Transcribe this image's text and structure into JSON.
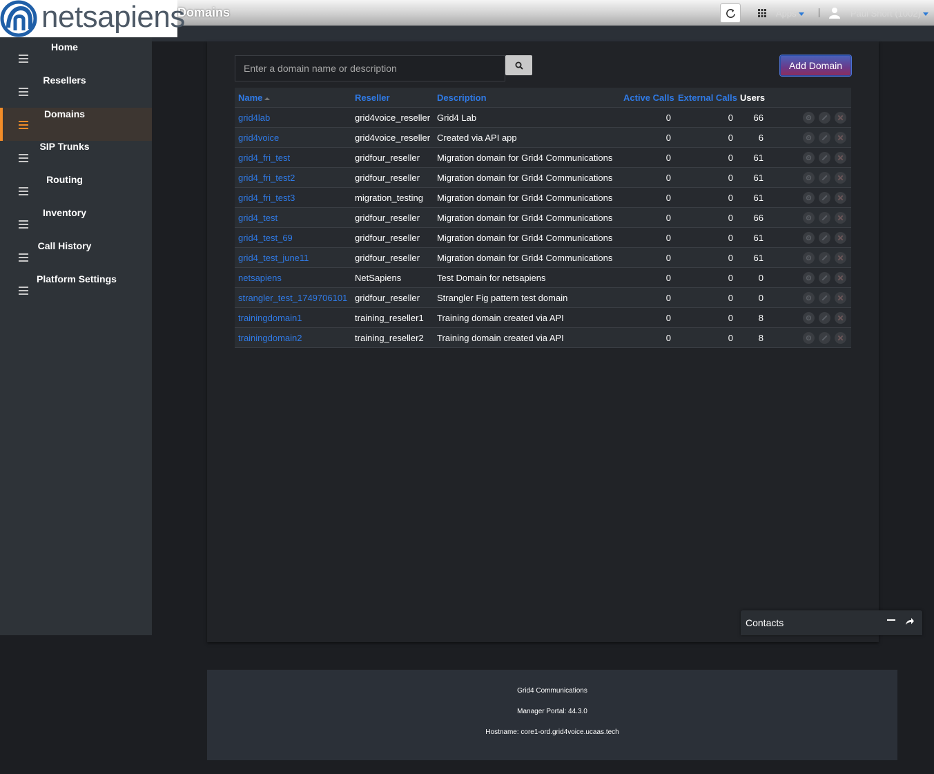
{
  "brand": {
    "logo_text": "netsapiens"
  },
  "header": {
    "page_title": "Domains",
    "apps_label": "Apps",
    "user_label": "Paul Short (1002)"
  },
  "sidebar": {
    "items": [
      {
        "label": "Home"
      },
      {
        "label": "Resellers"
      },
      {
        "label": "Domains",
        "active": true
      },
      {
        "label": "SIP Trunks"
      },
      {
        "label": "Routing"
      },
      {
        "label": "Inventory"
      },
      {
        "label": "Call History"
      },
      {
        "label": "Platform Settings"
      }
    ]
  },
  "search": {
    "placeholder": "Enter a domain name or description"
  },
  "toolbar": {
    "add_label": "Add Domain"
  },
  "table": {
    "headers": {
      "name": "Name",
      "reseller": "Reseller",
      "description": "Description",
      "active_calls": "Active Calls",
      "external_calls": "External Calls",
      "users": "Users"
    },
    "rows": [
      {
        "name": "grid4lab",
        "reseller": "grid4voice_reseller",
        "description": "Grid4 Lab",
        "active": "0",
        "external": "0",
        "users": "66"
      },
      {
        "name": "grid4voice",
        "reseller": "grid4voice_reseller",
        "description": "Created via API app",
        "active": "0",
        "external": "0",
        "users": "6"
      },
      {
        "name": "grid4_fri_test",
        "reseller": "gridfour_reseller",
        "description": "Migration domain for Grid4 Communications",
        "active": "0",
        "external": "0",
        "users": "61"
      },
      {
        "name": "grid4_fri_test2",
        "reseller": "gridfour_reseller",
        "description": "Migration domain for Grid4 Communications",
        "active": "0",
        "external": "0",
        "users": "61"
      },
      {
        "name": "grid4_fri_test3",
        "reseller": "migration_testing",
        "description": "Migration domain for Grid4 Communications",
        "active": "0",
        "external": "0",
        "users": "61"
      },
      {
        "name": "grid4_test",
        "reseller": "gridfour_reseller",
        "description": "Migration domain for Grid4 Communications",
        "active": "0",
        "external": "0",
        "users": "66"
      },
      {
        "name": "grid4_test_69",
        "reseller": "gridfour_reseller",
        "description": "Migration domain for Grid4 Communications",
        "active": "0",
        "external": "0",
        "users": "61"
      },
      {
        "name": "grid4_test_june11",
        "reseller": "gridfour_reseller",
        "description": "Migration domain for Grid4 Communications",
        "active": "0",
        "external": "0",
        "users": "61"
      },
      {
        "name": "netsapiens",
        "reseller": "NetSapiens",
        "description": "Test Domain for netsapiens",
        "active": "0",
        "external": "0",
        "users": "0"
      },
      {
        "name": "strangler_test_1749706101",
        "reseller": "gridfour_reseller",
        "description": "Strangler Fig pattern test domain",
        "active": "0",
        "external": "0",
        "users": "0"
      },
      {
        "name": "trainingdomain1",
        "reseller": "training_reseller1",
        "description": "Training domain created via API",
        "active": "0",
        "external": "0",
        "users": "8"
      },
      {
        "name": "trainingdomain2",
        "reseller": "training_reseller2",
        "description": "Training domain created via API",
        "active": "0",
        "external": "0",
        "users": "8"
      }
    ]
  },
  "contacts": {
    "label": "Contacts"
  },
  "footer": {
    "company": "Grid4 Communications",
    "version": "Manager Portal: 44.3.0",
    "hostname": "Hostname: core1-ord.grid4voice.ucaas.tech"
  },
  "colors": {
    "accent": "#f28c28",
    "link": "#2f7ae6",
    "background": "#1c1e22"
  },
  "icons": [
    "refresh-icon",
    "apps-grid-icon",
    "user-icon",
    "hamburger-icon",
    "search-icon",
    "gear-icon",
    "edit-icon",
    "delete-icon",
    "minimize-icon",
    "popout-icon"
  ]
}
